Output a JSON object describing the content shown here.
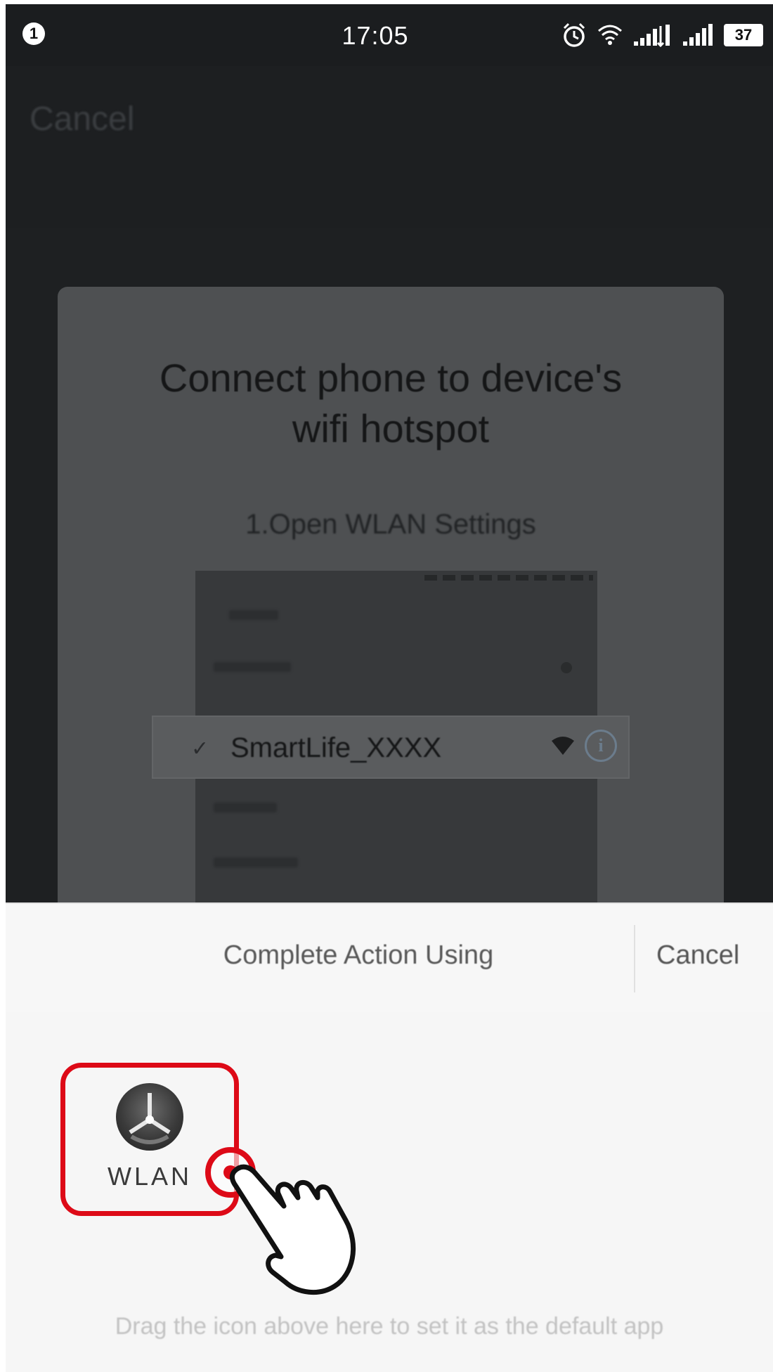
{
  "status_bar": {
    "notification_count": "1",
    "time": "17:05",
    "battery": "37",
    "icons": [
      "alarm-icon",
      "wifi-icon",
      "signal-icon",
      "signal-icon"
    ]
  },
  "app_header": {
    "cancel_label": "Cancel"
  },
  "dialog": {
    "title_line1": "Connect phone to device's",
    "title_line2": "wifi hotspot",
    "step": "1.Open WLAN Settings",
    "wifi_network": "SmartLife_XXXX"
  },
  "chooser": {
    "title": "Complete Action Using",
    "cancel_label": "Cancel",
    "app_label": "WLAN",
    "hint": "Drag the icon above here to set it as the default app"
  },
  "colors": {
    "highlight": "#dd0a17",
    "overlay": "#1e2022",
    "sheet_background": "#f6f6f6"
  }
}
